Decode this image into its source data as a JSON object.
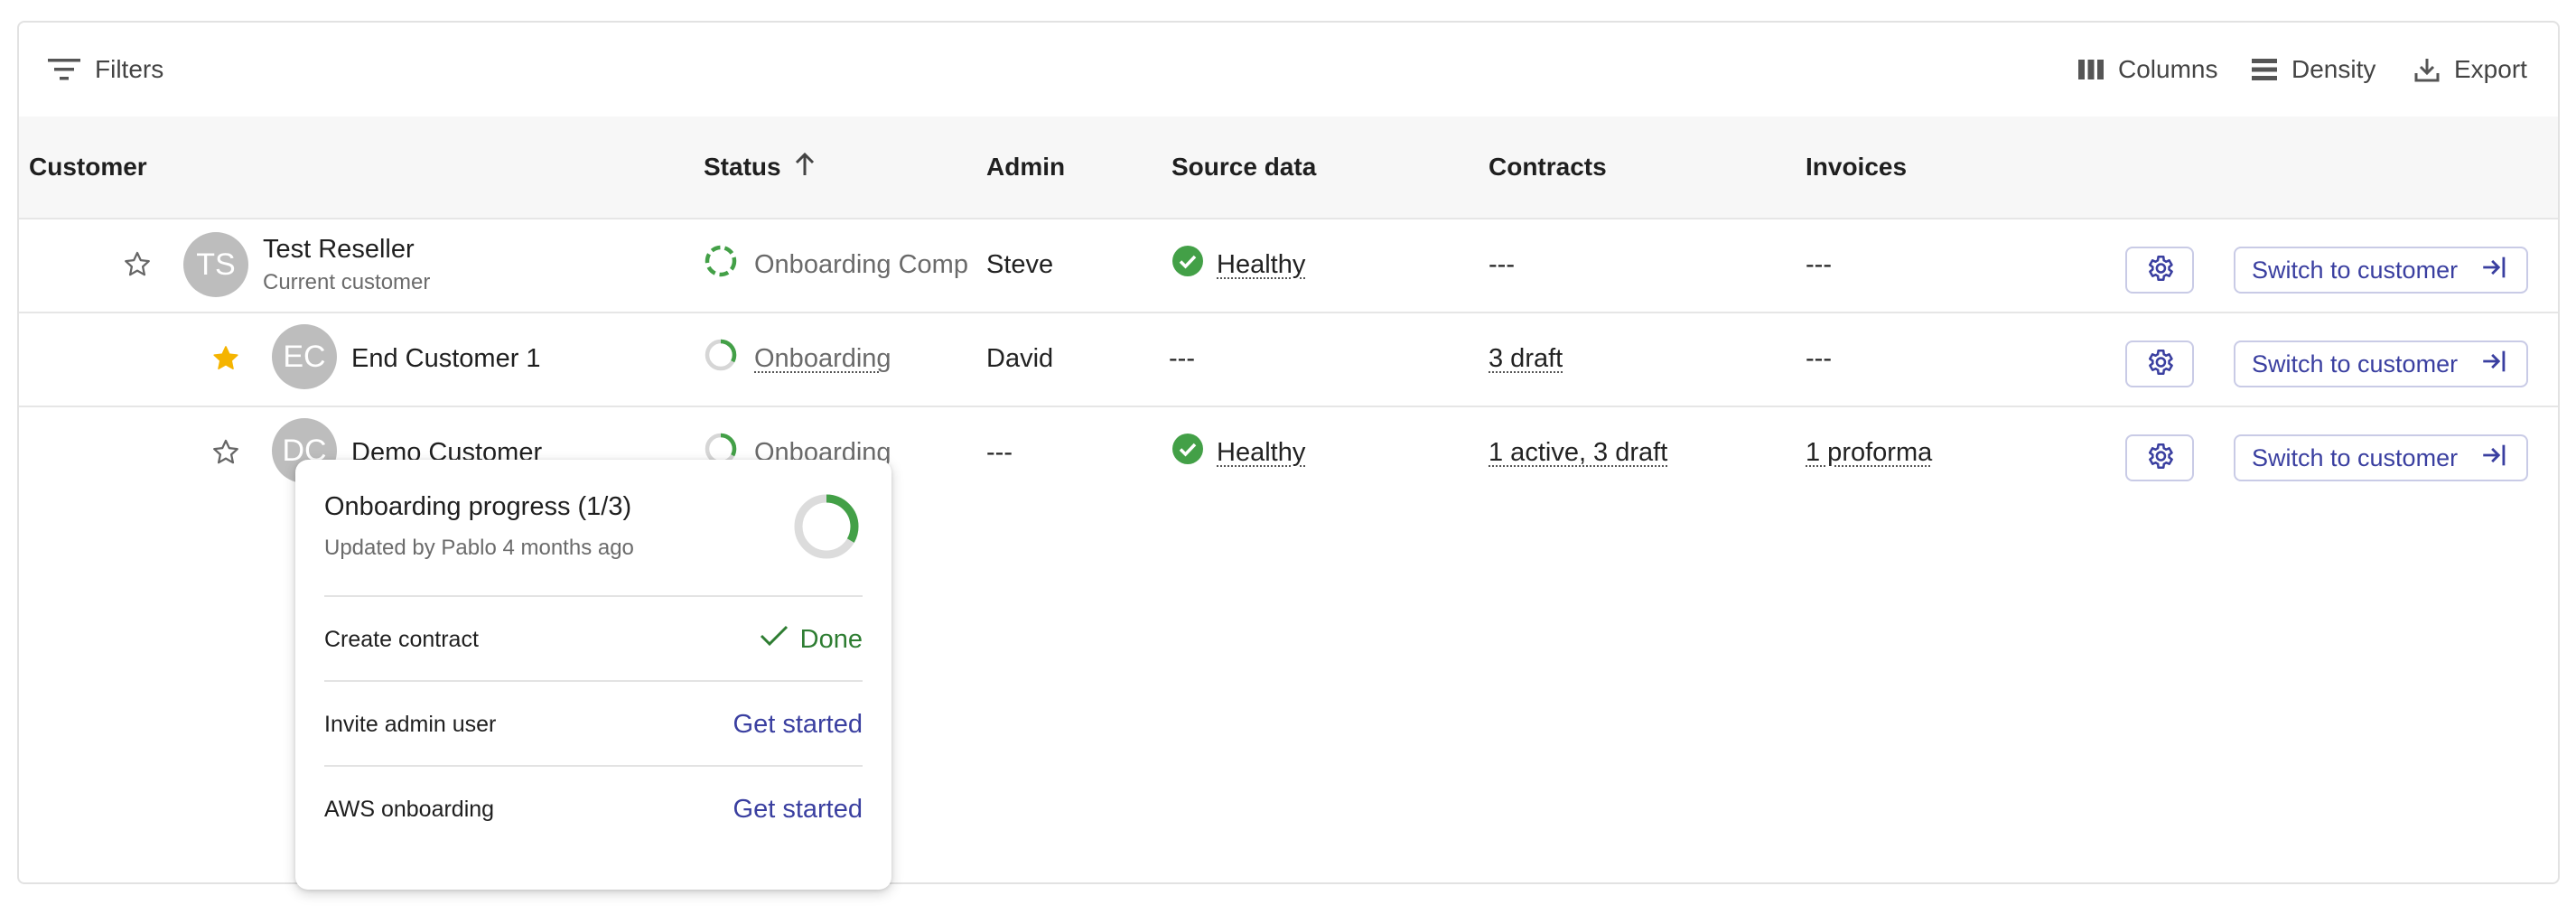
{
  "toolbar": {
    "filters_label": "Filters",
    "columns_label": "Columns",
    "density_label": "Density",
    "export_label": "Export"
  },
  "columns": {
    "customer": "Customer",
    "status": "Status",
    "admin": "Admin",
    "source_data": "Source data",
    "contracts": "Contracts",
    "invoices": "Invoices"
  },
  "rows": [
    {
      "starred": false,
      "initials": "TS",
      "name": "Test Reseller",
      "subtitle": "Current customer",
      "status": "Onboarding Comp",
      "admin": "Steve",
      "source_data": "Healthy",
      "contracts": "---",
      "invoices": "---",
      "action_label": "Switch to customer"
    },
    {
      "starred": true,
      "initials": "EC",
      "name": "End Customer 1",
      "status": "Onboarding",
      "admin": "David",
      "source_data": "---",
      "contracts": "3 draft",
      "invoices": "---",
      "action_label": "Switch to customer"
    },
    {
      "starred": false,
      "initials": "DC",
      "name": "Demo Customer",
      "status": "Onboarding",
      "admin": "---",
      "source_data": "Healthy",
      "contracts": "1 active, 3 draft",
      "invoices": "1 proforma",
      "action_label": "Switch to customer"
    }
  ],
  "popover": {
    "title": "Onboarding progress (1/3)",
    "subtitle": "Updated by Pablo 4 months ago",
    "progress": 0.3333,
    "steps": [
      {
        "label": "Create contract",
        "action": "Done"
      },
      {
        "label": "Invite admin user",
        "action": "Get started"
      },
      {
        "label": "AWS onboarding",
        "action": "Get started"
      }
    ]
  },
  "colors": {
    "accent": "#3a3fa0",
    "success": "#2e7d32",
    "healthy_icon": "#43a047",
    "star_filled": "#f5b400"
  }
}
